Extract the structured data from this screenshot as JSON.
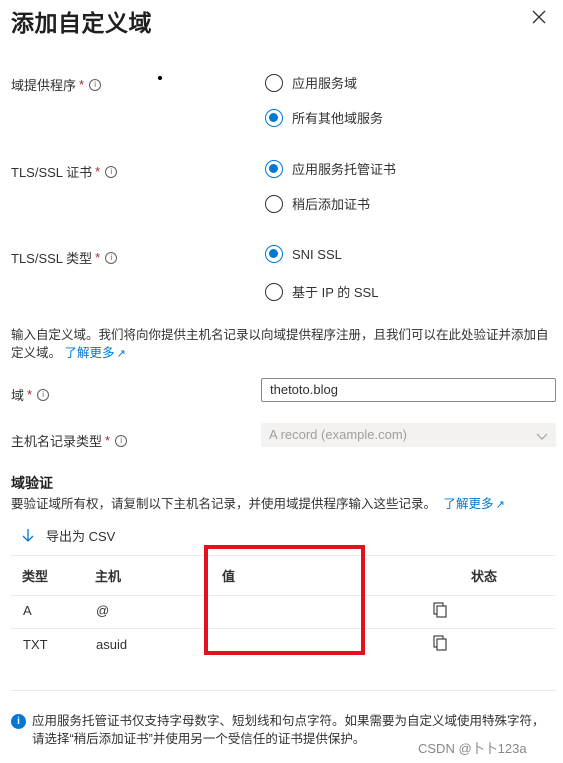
{
  "panel": {
    "title": "添加自定义域"
  },
  "form": {
    "provider": {
      "label": "域提供程序",
      "required": "*",
      "info": "i",
      "options": [
        "应用服务域",
        "所有其他域服务"
      ],
      "selected_index": 1
    },
    "cert": {
      "label": "TLS/SSL 证书",
      "required": "*",
      "info": "i",
      "options": [
        "应用服务托管证书",
        "稍后添加证书"
      ],
      "selected_index": 0
    },
    "ssl_type": {
      "label": "TLS/SSL 类型",
      "required": "*",
      "info": "i",
      "options": [
        "SNI SSL",
        "基于 IP 的 SSL"
      ],
      "selected_index": 0
    },
    "description": "输入自定义域。我们将向你提供主机名记录以向域提供程序注册，且我们可以在此处验证并添加自定义域。",
    "learn_more": "了解更多",
    "domain": {
      "label": "域",
      "required": "*",
      "info": "i",
      "value": "thetoto.blog"
    },
    "record_type": {
      "label": "主机名记录类型",
      "required": "*",
      "info": "i",
      "value": "A record (example.com)"
    }
  },
  "verification": {
    "heading": "域验证",
    "description": "要验证域所有权，请复制以下主机名记录，并使用域提供程序输入这些记录。",
    "learn_more": "了解更多",
    "export_label": "导出为 CSV",
    "columns": [
      "类型",
      "主机",
      "值",
      "状态"
    ],
    "rows": [
      {
        "type": "A",
        "host": "@",
        "value": ""
      },
      {
        "type": "TXT",
        "host": "asuid",
        "value": ""
      }
    ]
  },
  "notice": {
    "text": "应用服务托管证书仅支持字母数字、短划线和句点字符。如果需要为自定义域使用特殊字符，请选择“稍后添加证书”并使用另一个受信任的证书提供保护。"
  },
  "watermark": "CSDN @卜卜123a",
  "colors": {
    "accent": "#0078d4",
    "highlight_box": "#e3101e"
  }
}
